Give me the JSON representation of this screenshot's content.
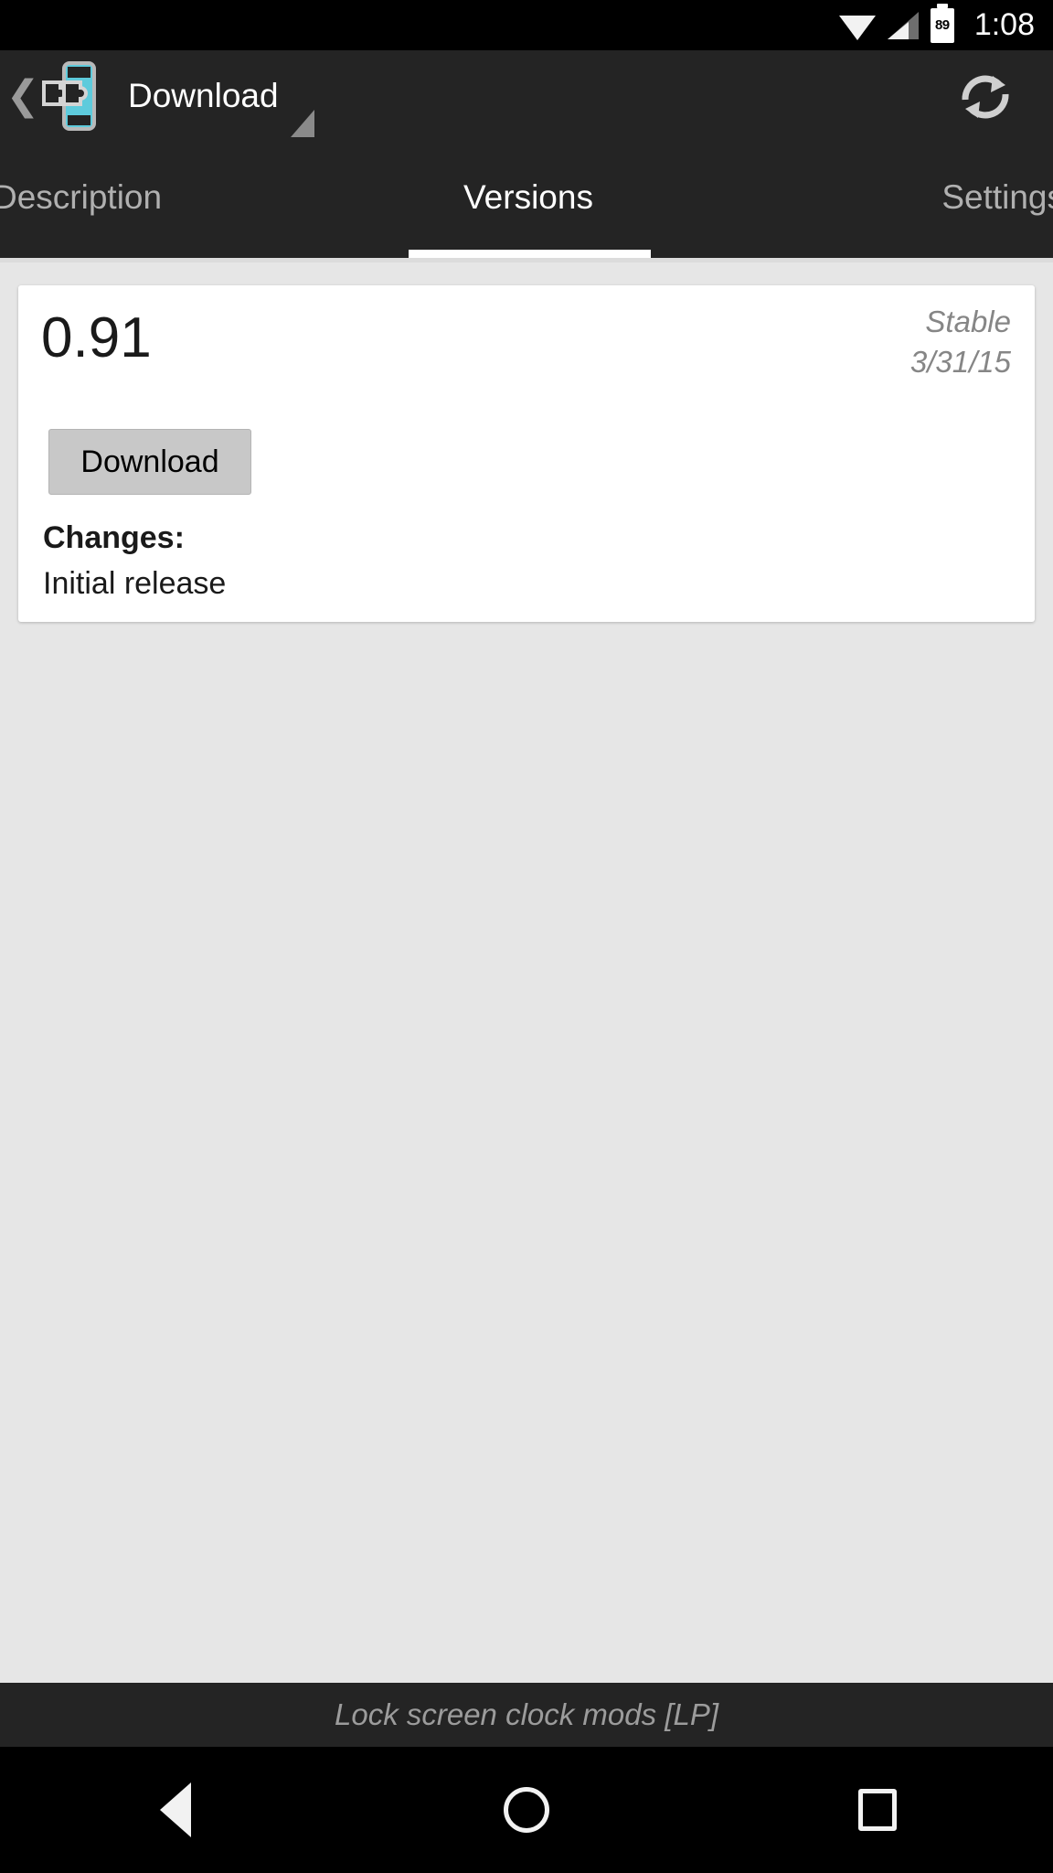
{
  "status_bar": {
    "wifi_icon": "wifi-icon",
    "signal_icon": "cell-signal-icon",
    "battery_icon": "battery-icon",
    "battery_level": "89",
    "time": "1:08"
  },
  "action_bar": {
    "back_chevron": "❮",
    "app_icon": "xposed-module-icon",
    "title": "Download",
    "spinner_caret": "dropdown-caret-icon",
    "refresh_icon": "refresh-icon"
  },
  "tabs": [
    {
      "label": "Description",
      "active": false
    },
    {
      "label": "Versions",
      "active": true
    },
    {
      "label": "Settings",
      "active": false
    }
  ],
  "version_card": {
    "version": "0.91",
    "channel": "Stable",
    "date": "3/31/15",
    "download_label": "Download",
    "changes_label": "Changes:",
    "changes_text": "Initial release"
  },
  "footer": {
    "text": "Lock screen clock mods [LP]"
  },
  "nav_bar": {
    "back": "back-triangle-icon",
    "home": "home-circle-icon",
    "recents": "recents-square-icon"
  },
  "colors": {
    "accent_cyan": "#5ecbdc",
    "chrome_dark": "#242424",
    "page_bg": "#e6e6e6",
    "card_bg": "#ffffff",
    "button_gray": "#c8c8c8"
  }
}
